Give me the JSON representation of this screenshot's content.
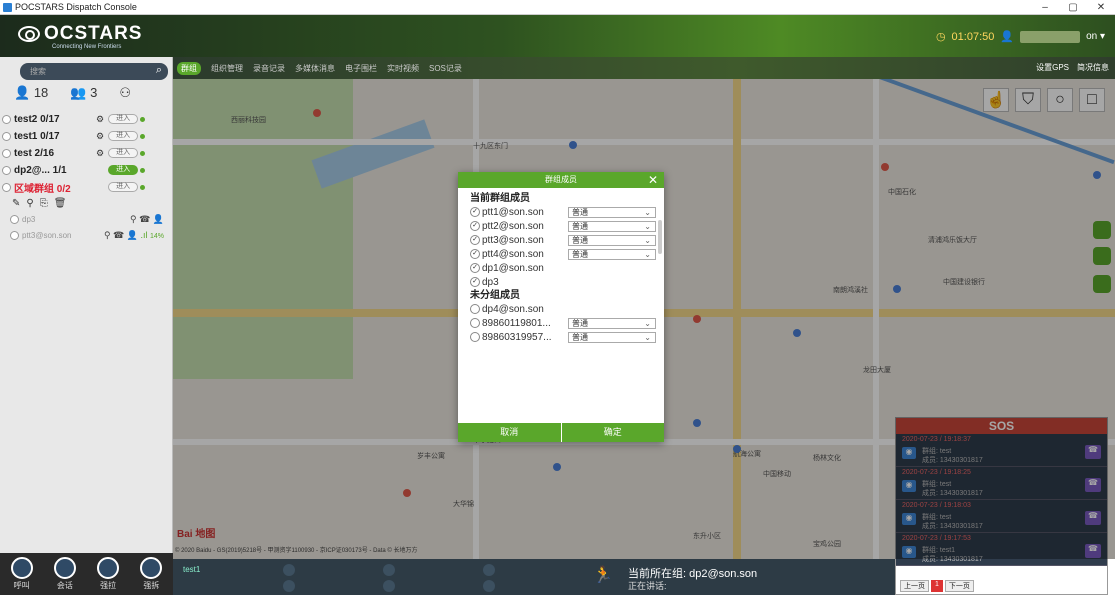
{
  "window": {
    "title": "POCSTARS Dispatch Console",
    "controls": [
      "–",
      "▢",
      "✕"
    ]
  },
  "header": {
    "logo_name": "OCSTARS",
    "logo_tag": "Connecting New Frontiers",
    "time": "01:07:50",
    "user_suffix": "on ▾"
  },
  "sidebar": {
    "search_placeholder": "搜索",
    "counts": {
      "all": "18",
      "online": "3"
    },
    "groups": [
      {
        "name": "test2 0/17",
        "btn": "进入"
      },
      {
        "name": "test1 0/17",
        "btn": "进入"
      },
      {
        "name": "test 2/16",
        "btn": "进入"
      },
      {
        "name": "dp2@... 1/1",
        "btn": "进入"
      },
      {
        "name": "区域群组 0/2",
        "btn": "进入"
      }
    ],
    "members": [
      {
        "name": "dp3"
      },
      {
        "name": "ptt3@son.son",
        "signal": "14%"
      }
    ],
    "bottom": {
      "call": "呼叫",
      "session": "会话",
      "pull": "强拉",
      "break": "强拆"
    }
  },
  "toolbar": {
    "items": [
      "群组",
      "组织管理",
      "录音记录",
      "多媒体消息",
      "电子围栏",
      "实时视频",
      "SOS记录"
    ],
    "right": [
      "设置GPS",
      "简况信息"
    ]
  },
  "map": {
    "labels": [
      "西丽科技园",
      "十九区东门",
      "中国石化",
      "清浦鸿乐饭大厅",
      "中国建设银行",
      "十字路口",
      "岁丰公寓",
      "航海公寓",
      "中国移动",
      "杨林文化",
      "大华锦",
      "东升小区",
      "宝鸡公园",
      "龙田大厦",
      "南朗鸿溪社",
      "SOS"
    ],
    "attribution": "© 2020 Baidu - GS(2019)5218号 - 甲测资字1100930 - 京ICP证030173号 - Data © 长地万方",
    "brand": "Bai 地图"
  },
  "bottombar": {
    "current_user": "test1",
    "group_label": "当前所在组: dp2@son.son",
    "talking": "正在讲话:"
  },
  "sos": {
    "title": "SOS",
    "entries": [
      {
        "time": "2020-07-23 / 19:18:37",
        "group": "群组: test",
        "number": "成员: 13430301817"
      },
      {
        "time": "2020-07-23 / 19:18:25",
        "group": "群组: test",
        "number": "成员: 13430301817"
      },
      {
        "time": "2020-07-23 / 19:18:03",
        "group": "群组: test",
        "number": "成员: 13430301817"
      },
      {
        "time": "2020-07-23 / 19:17:53",
        "group": "群组: test1",
        "number": "成员: 13430301817"
      }
    ],
    "pager": {
      "prev": "上一页",
      "current": "1",
      "next": "下一页"
    }
  },
  "modal": {
    "title": "群组成员",
    "current_section": "当前群组成员",
    "current_members": [
      {
        "name": "ptt1@son.son",
        "role": "普通"
      },
      {
        "name": "ptt2@son.son",
        "role": "普通"
      },
      {
        "name": "ptt3@son.son",
        "role": "普通"
      },
      {
        "name": "ptt4@son.son",
        "role": "普通"
      },
      {
        "name": "dp1@son.son",
        "role": ""
      },
      {
        "name": "dp3",
        "role": ""
      }
    ],
    "unassigned_section": "未分组成员",
    "unassigned_members": [
      {
        "name": "dp4@son.son",
        "role": ""
      },
      {
        "name": "89860119801...",
        "role": "普通"
      },
      {
        "name": "89860319957...",
        "role": "普通"
      }
    ],
    "cancel": "取消",
    "confirm": "确定"
  }
}
